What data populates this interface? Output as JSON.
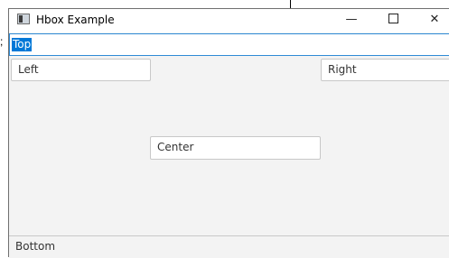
{
  "window": {
    "title": "Hbox Example",
    "controls": {
      "minimize": "—",
      "close": "✕"
    }
  },
  "fields": {
    "top": "Top",
    "left": "Left",
    "right": "Right",
    "center": "Center",
    "bottom": "Bottom"
  },
  "background": {
    "mark": ";"
  },
  "colors": {
    "focus_border": "#2f8bd6",
    "selection": "#0078d7",
    "window_bg": "#f3f3f3"
  }
}
